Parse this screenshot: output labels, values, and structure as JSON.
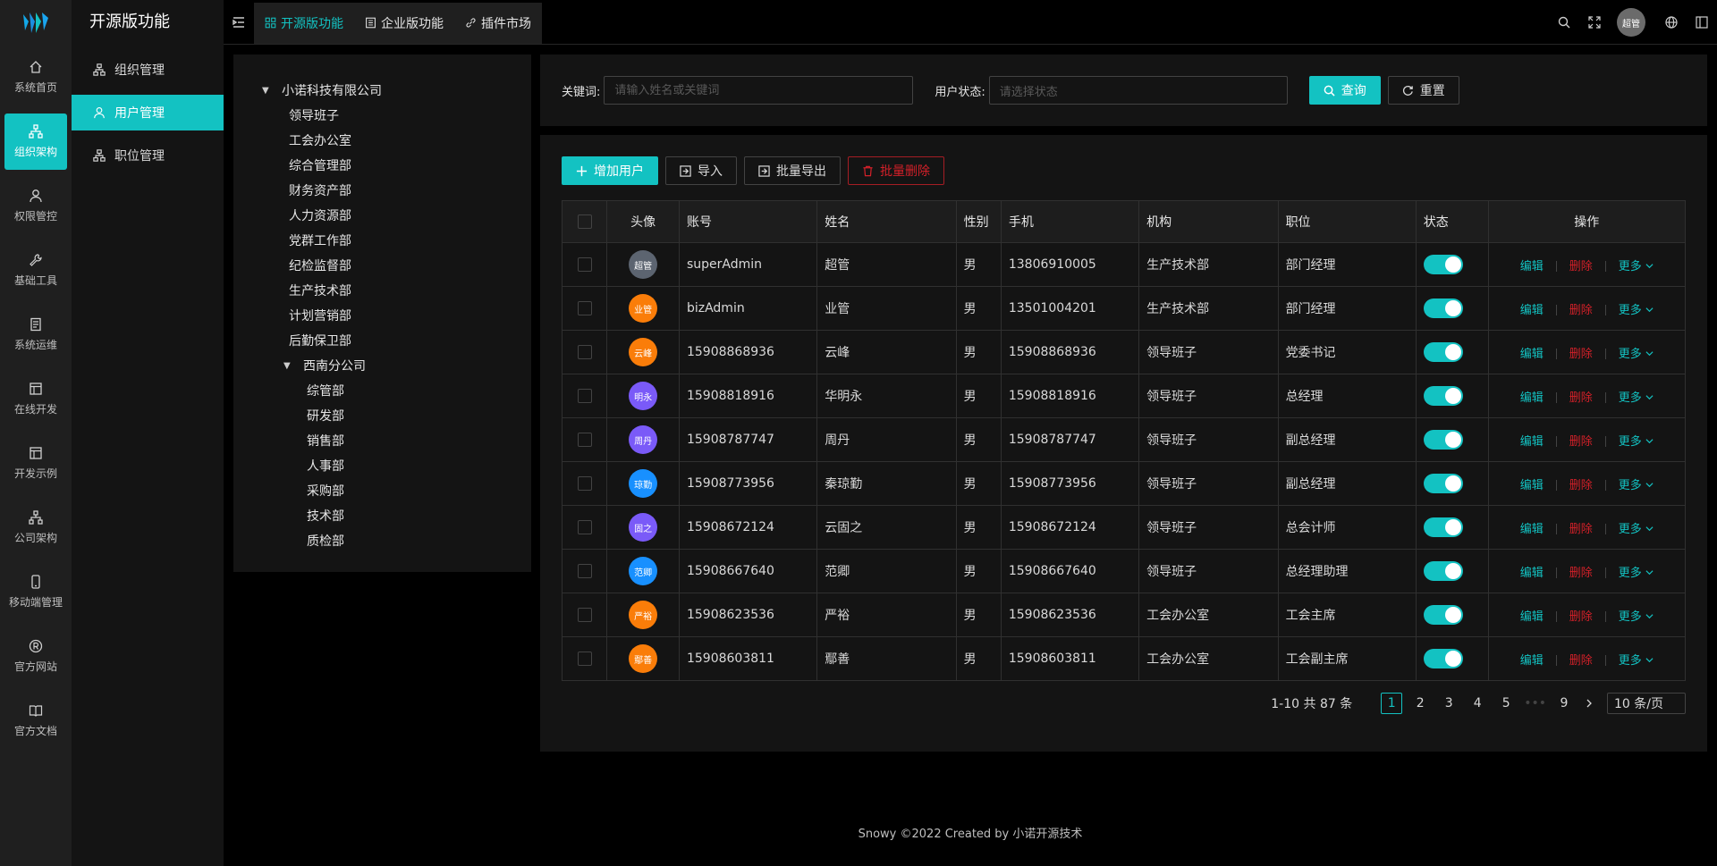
{
  "rail": [
    {
      "label": "系统首页",
      "icon": "home-icon"
    },
    {
      "label": "组织架构",
      "icon": "org-icon",
      "active": true
    },
    {
      "label": "权限管控",
      "icon": "user-icon"
    },
    {
      "label": "基础工具",
      "icon": "tool-icon"
    },
    {
      "label": "系统运维",
      "icon": "server-icon"
    },
    {
      "label": "在线开发",
      "icon": "code-icon"
    },
    {
      "label": "开发示例",
      "icon": "example-icon"
    },
    {
      "label": "公司架构",
      "icon": "company-icon"
    },
    {
      "label": "移动端管理",
      "icon": "mobile-icon"
    },
    {
      "label": "官方网站",
      "icon": "registered-icon"
    },
    {
      "label": "官方文档",
      "icon": "book-icon"
    }
  ],
  "submenu": {
    "title": "开源版功能",
    "items": [
      {
        "label": "组织管理",
        "icon": "cluster-icon"
      },
      {
        "label": "用户管理",
        "icon": "user-icon",
        "active": true
      },
      {
        "label": "职位管理",
        "icon": "cluster-icon"
      }
    ]
  },
  "header": {
    "tabs": [
      {
        "label": "开源版功能",
        "icon": "appstore-icon",
        "active": true
      },
      {
        "label": "企业版功能",
        "icon": "profile-icon"
      },
      {
        "label": "插件市场",
        "icon": "link-icon"
      }
    ],
    "avatar_text": "超管"
  },
  "tree": {
    "root": "小诺科技有限公司",
    "children": [
      "领导班子",
      "工会办公室",
      "综合管理部",
      "财务资产部",
      "人力资源部",
      "党群工作部",
      "纪检监督部",
      "生产技术部",
      "计划营销部",
      "后勤保卫部"
    ],
    "branch": "西南分公司",
    "branch_children": [
      "综管部",
      "研发部",
      "销售部",
      "人事部",
      "采购部",
      "技术部",
      "质检部"
    ]
  },
  "search": {
    "keyword_label": "关键词:",
    "keyword_placeholder": "请输入姓名或关键词",
    "status_label": "用户状态:",
    "status_placeholder": "请选择状态",
    "query_button": "查询",
    "reset_button": "重置"
  },
  "toolbar": {
    "add": "增加用户",
    "import": "导入",
    "export": "批量导出",
    "delete": "批量删除"
  },
  "table": {
    "columns": [
      "头像",
      "账号",
      "姓名",
      "性别",
      "手机",
      "机构",
      "职位",
      "状态",
      "操作"
    ],
    "rows": [
      {
        "avatar": "超管",
        "color": "#5c6470",
        "account": "superAdmin",
        "name": "超管",
        "gender": "男",
        "phone": "13806910005",
        "org": "生产技术部",
        "position": "部门经理"
      },
      {
        "avatar": "业管",
        "color": "#fa7d09",
        "account": "bizAdmin",
        "name": "业管",
        "gender": "男",
        "phone": "13501004201",
        "org": "生产技术部",
        "position": "部门经理"
      },
      {
        "avatar": "云峰",
        "color": "#fa7d09",
        "account": "15908868936",
        "name": "云峰",
        "gender": "男",
        "phone": "15908868936",
        "org": "领导班子",
        "position": "党委书记"
      },
      {
        "avatar": "明永",
        "color": "#7a5af8",
        "account": "15908818916",
        "name": "华明永",
        "gender": "男",
        "phone": "15908818916",
        "org": "领导班子",
        "position": "总经理"
      },
      {
        "avatar": "周丹",
        "color": "#7a5af8",
        "account": "15908787747",
        "name": "周丹",
        "gender": "男",
        "phone": "15908787747",
        "org": "领导班子",
        "position": "副总经理"
      },
      {
        "avatar": "琼勤",
        "color": "#1890ff",
        "account": "15908773956",
        "name": "秦琼勤",
        "gender": "男",
        "phone": "15908773956",
        "org": "领导班子",
        "position": "副总经理"
      },
      {
        "avatar": "固之",
        "color": "#7a5af8",
        "account": "15908672124",
        "name": "云固之",
        "gender": "男",
        "phone": "15908672124",
        "org": "领导班子",
        "position": "总会计师"
      },
      {
        "avatar": "范卿",
        "color": "#1890ff",
        "account": "15908667640",
        "name": "范卿",
        "gender": "男",
        "phone": "15908667640",
        "org": "领导班子",
        "position": "总经理助理"
      },
      {
        "avatar": "严裕",
        "color": "#fa7d09",
        "account": "15908623536",
        "name": "严裕",
        "gender": "男",
        "phone": "15908623536",
        "org": "工会办公室",
        "position": "工会主席"
      },
      {
        "avatar": "鄢善",
        "color": "#fa7d09",
        "account": "15908603811",
        "name": "鄢善",
        "gender": "男",
        "phone": "15908603811",
        "org": "工会办公室",
        "position": "工会副主席"
      }
    ],
    "op_edit": "编辑",
    "op_delete": "删除",
    "op_more": "更多"
  },
  "pagination": {
    "summary": "1-10 共 87 条",
    "pages": [
      "1",
      "2",
      "3",
      "4",
      "5",
      "•••",
      "9"
    ],
    "current": "1",
    "page_size": "10 条/页"
  },
  "footer": "Snowy ©2022 Created by 小诺开源技术",
  "colors": {
    "accent": "#13c2c2",
    "danger": "#d32029"
  }
}
